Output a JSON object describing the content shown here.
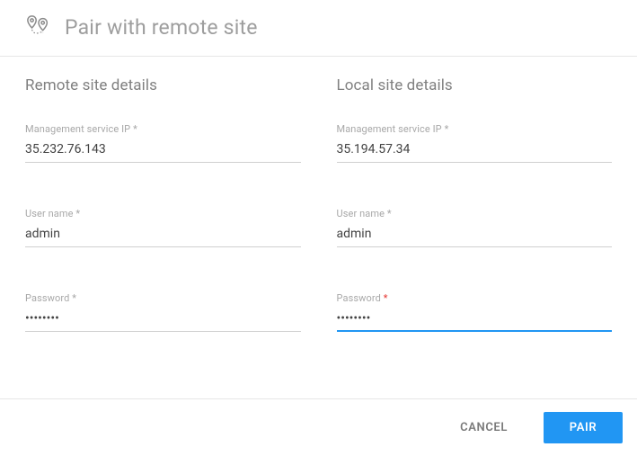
{
  "header": {
    "title": "Pair with remote site"
  },
  "remote": {
    "section_title": "Remote site details",
    "ip_label": "Management service IP",
    "ip_value": "35.232.76.143",
    "user_label": "User name",
    "user_value": "admin",
    "password_label": "Password",
    "password_value": "••••••••"
  },
  "local": {
    "section_title": "Local site details",
    "ip_label": "Management service IP",
    "ip_value": "35.194.57.34",
    "user_label": "User name",
    "user_value": "admin",
    "password_label": "Password",
    "password_value": "••••••••"
  },
  "footer": {
    "cancel_label": "CANCEL",
    "pair_label": "PAIR"
  },
  "required_marker": " *"
}
